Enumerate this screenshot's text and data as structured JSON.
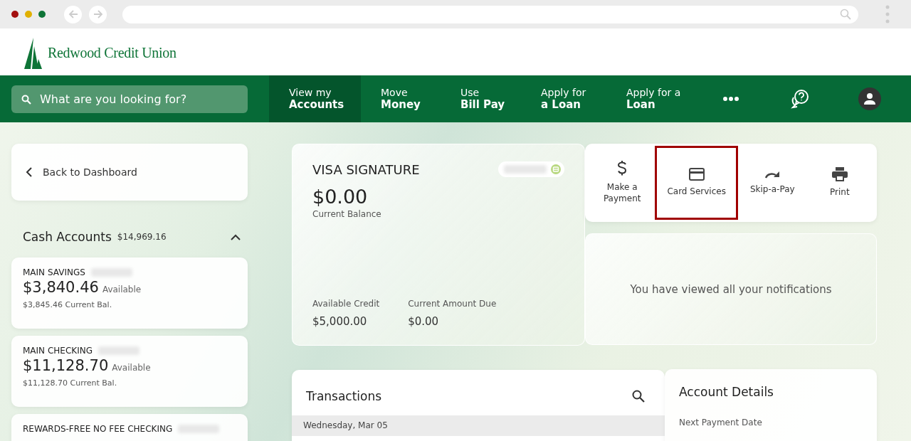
{
  "header": {
    "logo_text": "Redwood Credit Union"
  },
  "nav": {
    "search": {
      "placeholder": "What are you looking for?"
    },
    "items": [
      {
        "line1": "View my",
        "line2": "Accounts",
        "selected": true
      },
      {
        "line1": "Move",
        "line2": "Money",
        "selected": false
      },
      {
        "line1": "Use",
        "line2": "Bill Pay",
        "selected": false
      },
      {
        "line1": "Apply for",
        "line2": "a Loan",
        "selected": false
      },
      {
        "line1": "Apply for a",
        "line2": "Loan",
        "selected": false
      }
    ]
  },
  "sidebar": {
    "back_link": "Back to Dashboard",
    "group": {
      "title": "Cash Accounts",
      "total": "$14,969.16",
      "expanded": true
    },
    "accounts": [
      {
        "name": "MAIN SAVINGS",
        "number_hidden": true,
        "available": "$3,840.46",
        "available_label": "Available",
        "current": "$3,845.46 Current Bal."
      },
      {
        "name": "MAIN CHECKING",
        "number_hidden": true,
        "available": "$11,128.70",
        "available_label": "Available",
        "current": "$11,128.70 Current Bal."
      },
      {
        "name": "REWARDS-FREE NO FEE CHECKING",
        "number_hidden": true
      }
    ]
  },
  "card": {
    "title": "VISA SIGNATURE",
    "number_hidden": true,
    "balance": "$0.00",
    "balance_label": "Current Balance",
    "stats": [
      {
        "label": "Available Credit",
        "value": "$5,000.00"
      },
      {
        "label": "Current Amount Due",
        "value": "$0.00"
      }
    ]
  },
  "actions": [
    {
      "kind": "dollar",
      "label": "Make a Payment",
      "highlighted": false
    },
    {
      "kind": "card",
      "label": "Card Services",
      "highlighted": true
    },
    {
      "kind": "redo",
      "label": "Skip-a-Pay",
      "highlighted": false
    },
    {
      "kind": "print",
      "label": "Print",
      "highlighted": false
    }
  ],
  "notifications": {
    "message": "You have viewed all your notifications"
  },
  "transactions": {
    "title": "Transactions",
    "date_header": "Wednesday, Mar 05"
  },
  "account_details": {
    "title": "Account Details",
    "label": "Next Payment Date"
  }
}
